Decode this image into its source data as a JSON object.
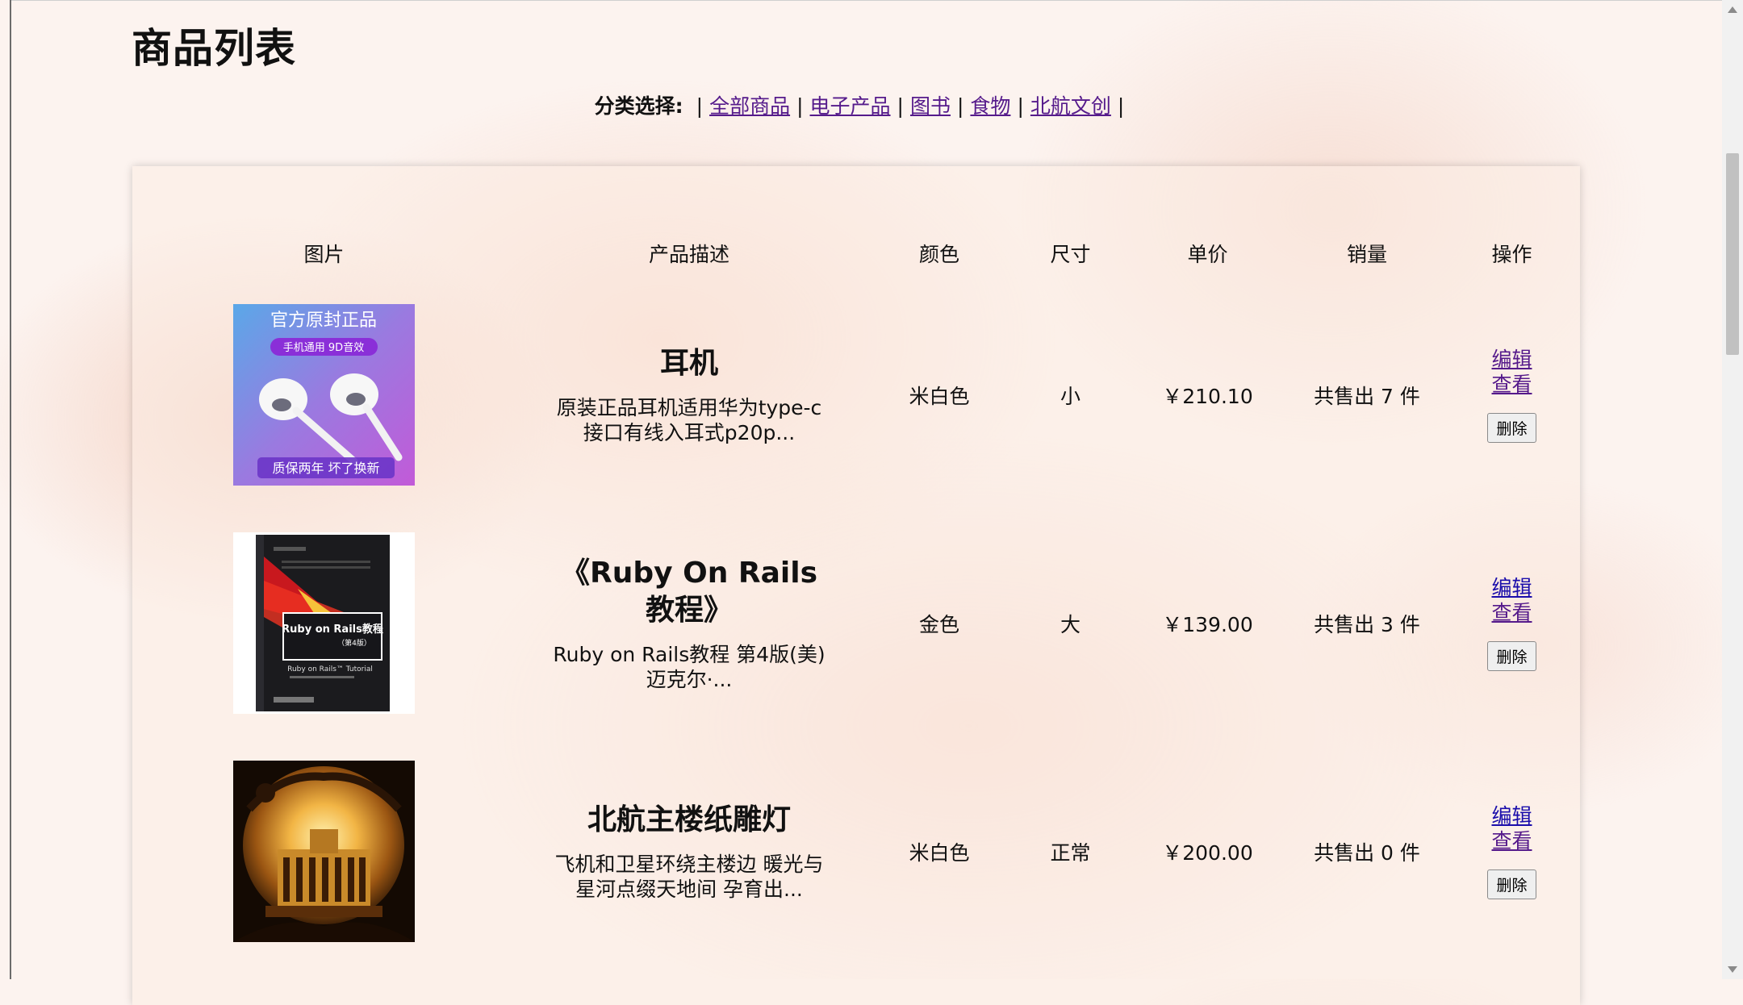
{
  "page": {
    "title": "商品列表"
  },
  "filter": {
    "label": "分类选择:",
    "separator": "|",
    "links": [
      "全部商品",
      "电子产品",
      "图书",
      "食物",
      "北航文创"
    ]
  },
  "table": {
    "headers": [
      "图片",
      "产品描述",
      "颜色",
      "尺寸",
      "单价",
      "销量",
      "操作"
    ],
    "rows": [
      {
        "image_text": {
          "top": "官方原封正品",
          "tag": "手机通用 9D音效",
          "bottom": "质保两年 坏了换新"
        },
        "name": "耳机",
        "desc": "原装正品耳机适用华为type-c接口有线入耳式p20p...",
        "color": "米白色",
        "size": "小",
        "price": "￥210.10",
        "sales": "共售出 7 件"
      },
      {
        "image_text": {
          "title": "Ruby on Rails教程",
          "edition": "（第4版）",
          "subtitle": "Ruby on Rails™ Tutorial"
        },
        "name": "《Ruby On Rails教程》",
        "desc": "Ruby on Rails教程 第4版(美) 迈克尔·...",
        "color": "金色",
        "size": "大",
        "price": "￥139.00",
        "sales": "共售出 3 件"
      },
      {
        "name": "北航主楼纸雕灯",
        "desc": "飞机和卫星环绕主楼边 暖光与星河点缀天地间 孕育出...",
        "color": "米白色",
        "size": "正常",
        "price": "￥200.00",
        "sales": "共售出 0 件"
      }
    ]
  },
  "actions": {
    "edit": "编辑",
    "view": "查看",
    "delete": "删除"
  },
  "colors": {
    "visited_link": "#551a8b",
    "link": "#1a0dab",
    "background": "#fcf3ef"
  }
}
